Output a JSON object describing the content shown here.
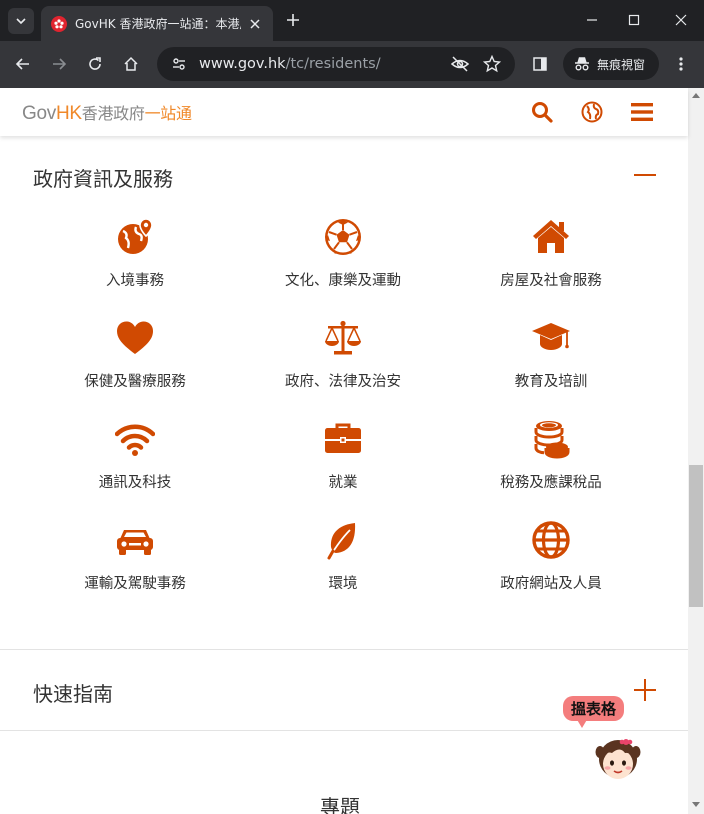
{
  "browser": {
    "tab": {
      "title": "GovHK 香港政府一站通：本港居民"
    },
    "url": {
      "host": "www.gov.hk",
      "path": "/tc/residents/"
    },
    "incognito_label": "無痕視窗"
  },
  "site": {
    "logo": {
      "gov": "Gov",
      "hk": "HK",
      "name_part1": "香港政府",
      "name_part2": "一站通"
    }
  },
  "sections": {
    "gov_info": {
      "title": "政府資訊及服務",
      "items": [
        {
          "label": "入境事務",
          "icon": "globe-pin-icon"
        },
        {
          "label": "文化、康樂及運動",
          "icon": "soccer-ball-icon"
        },
        {
          "label": "房屋及社會服務",
          "icon": "house-icon"
        },
        {
          "label": "保健及醫療服務",
          "icon": "heart-icon"
        },
        {
          "label": "政府、法律及治安",
          "icon": "scales-icon"
        },
        {
          "label": "教育及培訓",
          "icon": "graduation-cap-icon"
        },
        {
          "label": "通訊及科技",
          "icon": "wifi-icon"
        },
        {
          "label": "就業",
          "icon": "briefcase-icon"
        },
        {
          "label": "稅務及應課稅品",
          "icon": "coins-icon"
        },
        {
          "label": "運輸及駕駛事務",
          "icon": "car-icon"
        },
        {
          "label": "環境",
          "icon": "leaf-icon"
        },
        {
          "label": "政府網站及人員",
          "icon": "globe-icon"
        }
      ]
    },
    "quick_guide": {
      "title": "快速指南"
    },
    "topics": {
      "title": "專題"
    }
  },
  "widget": {
    "bubble": "搵表格"
  },
  "colors": {
    "accent": "#d04a02",
    "logo_orange": "#f0892a",
    "bubble": "#f47d7d"
  }
}
